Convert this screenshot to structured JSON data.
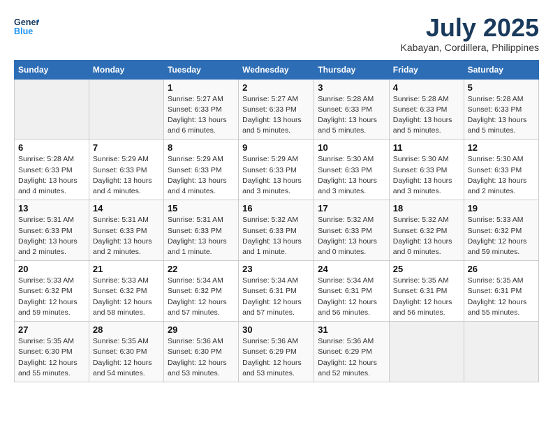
{
  "header": {
    "logo_general": "General",
    "logo_blue": "Blue",
    "month": "July 2025",
    "location": "Kabayan, Cordillera, Philippines"
  },
  "days_of_week": [
    "Sunday",
    "Monday",
    "Tuesday",
    "Wednesday",
    "Thursday",
    "Friday",
    "Saturday"
  ],
  "weeks": [
    [
      {
        "day": "",
        "empty": true
      },
      {
        "day": "",
        "empty": true
      },
      {
        "day": "1",
        "sunrise": "Sunrise: 5:27 AM",
        "sunset": "Sunset: 6:33 PM",
        "daylight": "Daylight: 13 hours and 6 minutes."
      },
      {
        "day": "2",
        "sunrise": "Sunrise: 5:27 AM",
        "sunset": "Sunset: 6:33 PM",
        "daylight": "Daylight: 13 hours and 5 minutes."
      },
      {
        "day": "3",
        "sunrise": "Sunrise: 5:28 AM",
        "sunset": "Sunset: 6:33 PM",
        "daylight": "Daylight: 13 hours and 5 minutes."
      },
      {
        "day": "4",
        "sunrise": "Sunrise: 5:28 AM",
        "sunset": "Sunset: 6:33 PM",
        "daylight": "Daylight: 13 hours and 5 minutes."
      },
      {
        "day": "5",
        "sunrise": "Sunrise: 5:28 AM",
        "sunset": "Sunset: 6:33 PM",
        "daylight": "Daylight: 13 hours and 5 minutes."
      }
    ],
    [
      {
        "day": "6",
        "sunrise": "Sunrise: 5:28 AM",
        "sunset": "Sunset: 6:33 PM",
        "daylight": "Daylight: 13 hours and 4 minutes."
      },
      {
        "day": "7",
        "sunrise": "Sunrise: 5:29 AM",
        "sunset": "Sunset: 6:33 PM",
        "daylight": "Daylight: 13 hours and 4 minutes."
      },
      {
        "day": "8",
        "sunrise": "Sunrise: 5:29 AM",
        "sunset": "Sunset: 6:33 PM",
        "daylight": "Daylight: 13 hours and 4 minutes."
      },
      {
        "day": "9",
        "sunrise": "Sunrise: 5:29 AM",
        "sunset": "Sunset: 6:33 PM",
        "daylight": "Daylight: 13 hours and 3 minutes."
      },
      {
        "day": "10",
        "sunrise": "Sunrise: 5:30 AM",
        "sunset": "Sunset: 6:33 PM",
        "daylight": "Daylight: 13 hours and 3 minutes."
      },
      {
        "day": "11",
        "sunrise": "Sunrise: 5:30 AM",
        "sunset": "Sunset: 6:33 PM",
        "daylight": "Daylight: 13 hours and 3 minutes."
      },
      {
        "day": "12",
        "sunrise": "Sunrise: 5:30 AM",
        "sunset": "Sunset: 6:33 PM",
        "daylight": "Daylight: 13 hours and 2 minutes."
      }
    ],
    [
      {
        "day": "13",
        "sunrise": "Sunrise: 5:31 AM",
        "sunset": "Sunset: 6:33 PM",
        "daylight": "Daylight: 13 hours and 2 minutes."
      },
      {
        "day": "14",
        "sunrise": "Sunrise: 5:31 AM",
        "sunset": "Sunset: 6:33 PM",
        "daylight": "Daylight: 13 hours and 2 minutes."
      },
      {
        "day": "15",
        "sunrise": "Sunrise: 5:31 AM",
        "sunset": "Sunset: 6:33 PM",
        "daylight": "Daylight: 13 hours and 1 minute."
      },
      {
        "day": "16",
        "sunrise": "Sunrise: 5:32 AM",
        "sunset": "Sunset: 6:33 PM",
        "daylight": "Daylight: 13 hours and 1 minute."
      },
      {
        "day": "17",
        "sunrise": "Sunrise: 5:32 AM",
        "sunset": "Sunset: 6:33 PM",
        "daylight": "Daylight: 13 hours and 0 minutes."
      },
      {
        "day": "18",
        "sunrise": "Sunrise: 5:32 AM",
        "sunset": "Sunset: 6:32 PM",
        "daylight": "Daylight: 13 hours and 0 minutes."
      },
      {
        "day": "19",
        "sunrise": "Sunrise: 5:33 AM",
        "sunset": "Sunset: 6:32 PM",
        "daylight": "Daylight: 12 hours and 59 minutes."
      }
    ],
    [
      {
        "day": "20",
        "sunrise": "Sunrise: 5:33 AM",
        "sunset": "Sunset: 6:32 PM",
        "daylight": "Daylight: 12 hours and 59 minutes."
      },
      {
        "day": "21",
        "sunrise": "Sunrise: 5:33 AM",
        "sunset": "Sunset: 6:32 PM",
        "daylight": "Daylight: 12 hours and 58 minutes."
      },
      {
        "day": "22",
        "sunrise": "Sunrise: 5:34 AM",
        "sunset": "Sunset: 6:32 PM",
        "daylight": "Daylight: 12 hours and 57 minutes."
      },
      {
        "day": "23",
        "sunrise": "Sunrise: 5:34 AM",
        "sunset": "Sunset: 6:31 PM",
        "daylight": "Daylight: 12 hours and 57 minutes."
      },
      {
        "day": "24",
        "sunrise": "Sunrise: 5:34 AM",
        "sunset": "Sunset: 6:31 PM",
        "daylight": "Daylight: 12 hours and 56 minutes."
      },
      {
        "day": "25",
        "sunrise": "Sunrise: 5:35 AM",
        "sunset": "Sunset: 6:31 PM",
        "daylight": "Daylight: 12 hours and 56 minutes."
      },
      {
        "day": "26",
        "sunrise": "Sunrise: 5:35 AM",
        "sunset": "Sunset: 6:31 PM",
        "daylight": "Daylight: 12 hours and 55 minutes."
      }
    ],
    [
      {
        "day": "27",
        "sunrise": "Sunrise: 5:35 AM",
        "sunset": "Sunset: 6:30 PM",
        "daylight": "Daylight: 12 hours and 55 minutes."
      },
      {
        "day": "28",
        "sunrise": "Sunrise: 5:35 AM",
        "sunset": "Sunset: 6:30 PM",
        "daylight": "Daylight: 12 hours and 54 minutes."
      },
      {
        "day": "29",
        "sunrise": "Sunrise: 5:36 AM",
        "sunset": "Sunset: 6:30 PM",
        "daylight": "Daylight: 12 hours and 53 minutes."
      },
      {
        "day": "30",
        "sunrise": "Sunrise: 5:36 AM",
        "sunset": "Sunset: 6:29 PM",
        "daylight": "Daylight: 12 hours and 53 minutes."
      },
      {
        "day": "31",
        "sunrise": "Sunrise: 5:36 AM",
        "sunset": "Sunset: 6:29 PM",
        "daylight": "Daylight: 12 hours and 52 minutes."
      },
      {
        "day": "",
        "empty": true
      },
      {
        "day": "",
        "empty": true
      }
    ]
  ]
}
